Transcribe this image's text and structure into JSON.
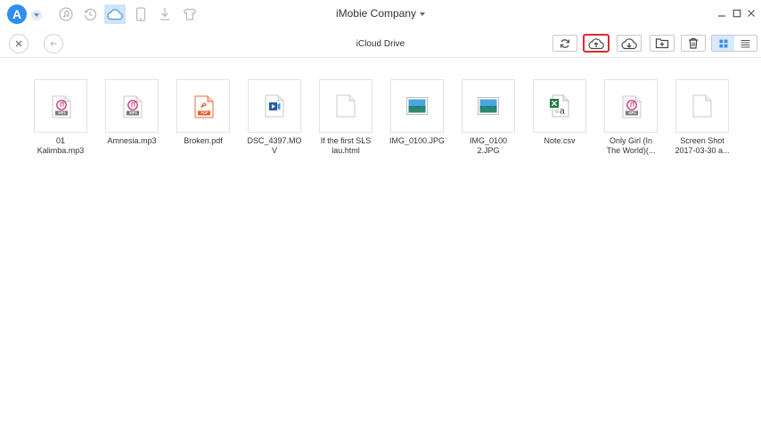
{
  "window": {
    "title": "iMobie Company",
    "logo_letter": "A"
  },
  "nav_icons": [
    "music-icon",
    "history-icon",
    "icloud-icon",
    "phone-icon",
    "download-icon",
    "tshirt-icon"
  ],
  "toolbar": {
    "location": "iCloud Drive"
  },
  "colors": {
    "accent": "#2d8ff0",
    "highlight": "#e0282e",
    "active_bg": "#cfe4f7"
  },
  "files": [
    {
      "line1": "01",
      "line2": "Kalimba.mp3",
      "type": "mp3"
    },
    {
      "line1": "Amnesia.mp3",
      "line2": "",
      "type": "mp3"
    },
    {
      "line1": "Broken.pdf",
      "line2": "",
      "type": "pdf"
    },
    {
      "line1": "DSC_4397.MO",
      "line2": "V",
      "type": "mov"
    },
    {
      "line1": "If the first SLS",
      "line2": "lau.html",
      "type": "html"
    },
    {
      "line1": "IMG_0100.JPG",
      "line2": "",
      "type": "jpg"
    },
    {
      "line1": "IMG_0100",
      "line2": "2.JPG",
      "type": "jpg"
    },
    {
      "line1": "Note.csv",
      "line2": "",
      "type": "csv"
    },
    {
      "line1": "Only Girl (In",
      "line2": "The World)(...",
      "type": "mp3"
    },
    {
      "line1": "Screen Shot",
      "line2": "2017-03-30 a...",
      "type": "blank"
    }
  ],
  "badges": {
    "mp3": "MP3",
    "pdf": "PDF"
  }
}
